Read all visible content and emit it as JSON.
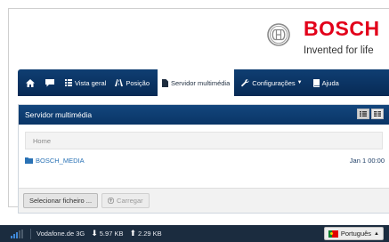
{
  "brand": {
    "name": "BOSCH",
    "tagline": "Invented for life",
    "color": "#e2001a"
  },
  "nav": {
    "items": [
      {
        "label": "",
        "icon": "home-icon"
      },
      {
        "label": "",
        "icon": "chat-icon"
      },
      {
        "label": "Vista geral",
        "icon": "grid-icon"
      },
      {
        "label": "Posição",
        "icon": "road-icon"
      },
      {
        "label": "Servidor multimédia",
        "icon": "file-icon",
        "active": true
      },
      {
        "label": "Configurações",
        "icon": "wrench-icon",
        "dropdown": true
      },
      {
        "label": "Ajuda",
        "icon": "book-icon"
      }
    ]
  },
  "panel": {
    "title": "Servidor multimédia",
    "breadcrumb": "Home",
    "files": [
      {
        "name": "BOSCH_MEDIA",
        "date": "Jan 1 00:00",
        "icon": "folder-icon"
      }
    ],
    "select_file_label": "Selecionar ficheiro ...",
    "upload_label": "Carregar"
  },
  "statusbar": {
    "network": "Vodafone.de 3G",
    "download": "5.97 KB",
    "upload": "2.29 KB",
    "language": "Português"
  }
}
